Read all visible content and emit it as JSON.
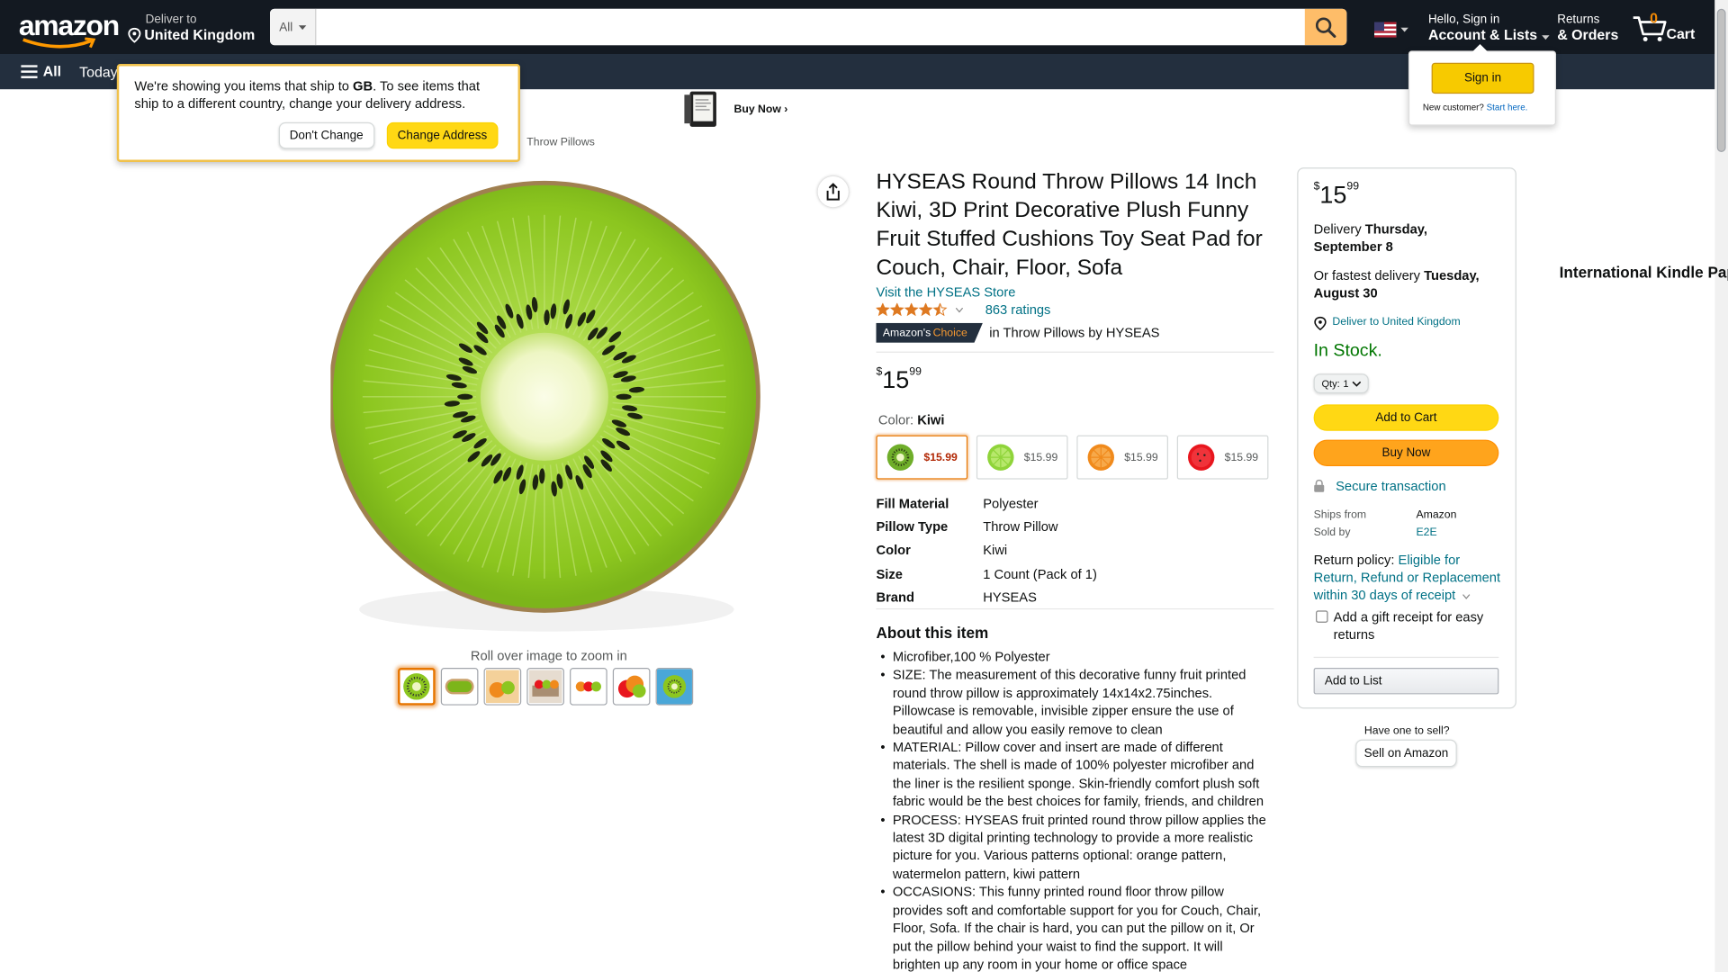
{
  "header": {
    "deliver_line1": "Deliver to",
    "deliver_line2": "United Kingdom",
    "search_dept": "All",
    "search_placeholder": "",
    "account_line1": "Hello, Sign in",
    "account_line2": "Account & Lists",
    "returns_line1": "Returns",
    "returns_line2": "& Orders",
    "cart_count": "0",
    "cart_label": "Cart"
  },
  "subnav": {
    "all_label": "All",
    "today_label": "Today's"
  },
  "banner": {
    "title": "International Kindle Paperwhite",
    "cta": "Buy Now ›"
  },
  "breadcrumb": "Throw Pillows",
  "popover": {
    "text_before": "We're showing you items that ship to ",
    "country": "GB",
    "text_after": ". To see items that ship to a different country, change your delivery address.",
    "dont_change": "Don't Change",
    "change_address": "Change Address"
  },
  "signin_flyout": {
    "button": "Sign in",
    "new_customer": "New customer?",
    "start_here": "Start here."
  },
  "gallery": {
    "zoom_hint": "Roll over image to zoom in",
    "thumb_count": 7,
    "main_image": "kiwi-slice"
  },
  "product": {
    "title": "HYSEAS Round Throw Pillows 14 Inch Kiwi, 3D Print Decorative Plush Funny Fruit Stuffed Cushions Toy Seat Pad for Couch, Chair, Floor, Sofa",
    "store_link": "Visit the HYSEAS Store",
    "rating_value": 4.5,
    "ratings_count": "863 ratings",
    "badge_prefix": "Amazon's",
    "badge_word": "Choice",
    "badge_context": "in Throw Pillows by HYSEAS",
    "price_symbol": "$",
    "price_whole": "15",
    "price_fraction": "99",
    "color_label": "Color:",
    "color_value": "Kiwi",
    "swatches": [
      {
        "price": "$15.99",
        "color": "#6fae2a"
      },
      {
        "price": "$15.99",
        "color": "#8fd43a"
      },
      {
        "price": "$15.99",
        "color": "#f08a1c"
      },
      {
        "price": "$15.99",
        "color": "#e8161e"
      }
    ],
    "specs": [
      {
        "key": "Fill Material",
        "value": "Polyester"
      },
      {
        "key": "Pillow Type",
        "value": "Throw Pillow"
      },
      {
        "key": "Color",
        "value": "Kiwi"
      },
      {
        "key": "Size",
        "value": "1 Count (Pack of 1)"
      },
      {
        "key": "Brand",
        "value": "HYSEAS"
      }
    ],
    "about_heading": "About this item",
    "about_items": [
      "Microfiber,100 % Polyester",
      "SIZE: The measurement of this decorative funny fruit printed round throw pillow is approximately 14x14x2.75inches. Pillowcase is removable, invisible zipper ensure the use of beautiful and allow you easily remove to clean",
      "MATERIAL: Pillow cover and insert are made of different materials. The shell is made of 100% polyester microfiber and the liner is the resilient sponge. Skin-friendly comfort plush soft fabric would be the best choices for family, friends, and children",
      "PROCESS: HYSEAS fruit printed round throw pillow applies the latest 3D digital printing technology to provide a more realistic picture for you. Various patterns optional: orange pattern, watermelon pattern, kiwi pattern",
      "OCCASIONS: This funny printed round floor throw pillow provides soft and comfortable support for you for Couch, Chair, Floor, Sofa. If the chair is hard, you can put the pillow on it, Or put the pillow behind your waist to find the support. It will brighten up any room in your home or office space"
    ]
  },
  "buybox": {
    "price_symbol": "$",
    "price_whole": "15",
    "price_fraction": "99",
    "delivery_label": "Delivery",
    "delivery_date": "Thursday, September 8",
    "fastest_label": "Or fastest delivery",
    "fastest_date": "Tuesday, August 30",
    "deliver_to": "Deliver to United Kingdom",
    "stock": "In Stock.",
    "qty_label": "Qty:",
    "qty_value": "1",
    "add_to_cart": "Add to Cart",
    "buy_now": "Buy Now",
    "secure": "Secure transaction",
    "ships_from_label": "Ships from",
    "ships_from_value": "Amazon",
    "sold_by_label": "Sold by",
    "sold_by_value": "E2E",
    "return_label": "Return policy:",
    "return_link": "Eligible for Return, Refund or Replacement within 30 days of receipt",
    "gift_receipt": "Add a gift receipt for easy returns",
    "add_to_list": "Add to List"
  },
  "sell": {
    "question": "Have one to sell?",
    "button": "Sell on Amazon"
  },
  "colors": {
    "nav_bg": "#131921",
    "subnav_bg": "#232f3e",
    "search_btn": "#febd69",
    "link": "#007185",
    "in_stock": "#007600",
    "cart_btn": "#ffd814",
    "buy_btn": "#ffa41c"
  }
}
